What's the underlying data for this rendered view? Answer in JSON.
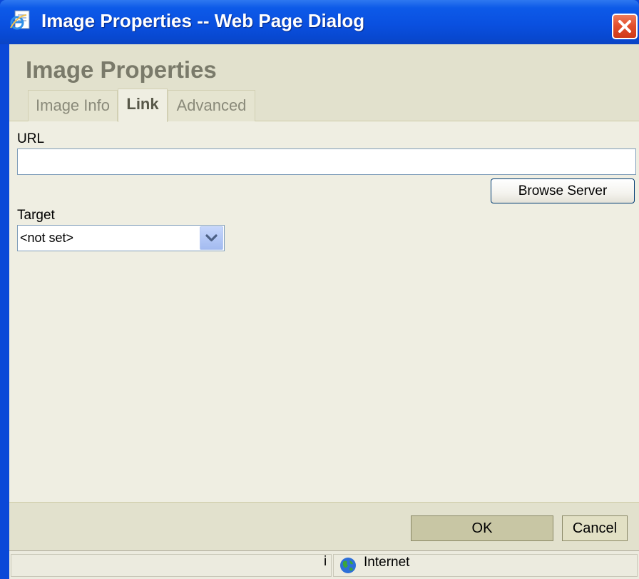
{
  "window": {
    "title": "Image Properties -- Web Page Dialog"
  },
  "dialog": {
    "heading": "Image Properties",
    "tabs": [
      {
        "label": "Image Info",
        "active": false
      },
      {
        "label": "Link",
        "active": true
      },
      {
        "label": "Advanced",
        "active": false
      }
    ]
  },
  "link": {
    "url_label": "URL",
    "url_value": "",
    "browse_label": "Browse Server",
    "target_label": "Target",
    "target_value": "<not set>"
  },
  "footer": {
    "ok_label": "OK",
    "cancel_label": "Cancel"
  },
  "statusbar": {
    "indicator": "i",
    "zone": "Internet"
  },
  "icons": {
    "title_icon": "ie-page-icon",
    "close_icon": "close-icon",
    "dropdown_icon": "chevron-down-icon",
    "zone_icon": "globe-icon"
  },
  "colors": {
    "titlebar": "#0a50e0",
    "client_bg": "#efeee2",
    "header_band": "#e2e1cd",
    "close_button": "#e2502e"
  }
}
